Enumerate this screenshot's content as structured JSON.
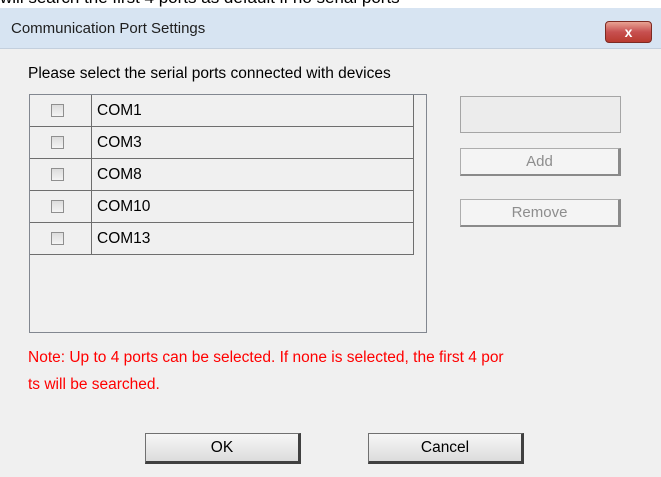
{
  "background_text": "will search the first 4 ports as default if no serial ports",
  "dialog": {
    "title": "Communication Port Settings",
    "close_label": "x"
  },
  "instruction": "Please select the serial ports connected with devices",
  "ports": [
    {
      "label": "COM1",
      "checked": false
    },
    {
      "label": "COM3",
      "checked": false
    },
    {
      "label": "COM8",
      "checked": false
    },
    {
      "label": "COM10",
      "checked": false
    },
    {
      "label": "COM13",
      "checked": false
    }
  ],
  "side_panel": {
    "port_input_value": "",
    "add_label": "Add",
    "remove_label": "Remove"
  },
  "note": {
    "line1": "Note: Up to 4 ports can be selected. If none is selected, the first 4 por",
    "line2": "ts will be searched."
  },
  "buttons": {
    "ok_label": "OK",
    "cancel_label": "Cancel"
  },
  "colors": {
    "note_text": "#ff0000",
    "titlebar": "#d7e4f2",
    "close_button": "#c75050"
  }
}
